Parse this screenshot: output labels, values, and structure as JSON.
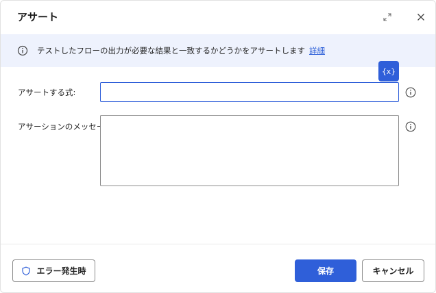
{
  "dialog": {
    "title": "アサート",
    "icons": {
      "expand": "expand-icon",
      "close": "close-icon"
    }
  },
  "info_bar": {
    "icon": "info-icon",
    "text": "テストしたフローの出力が必要な結果と一致するかどうかをアサートします",
    "link": "詳細"
  },
  "variables_button": {
    "label": "{x}"
  },
  "fields": {
    "expression": {
      "label": "アサートする式:",
      "value": "",
      "help_icon": "info-icon"
    },
    "message": {
      "label": "アサーションのメッセージ:",
      "value": "",
      "help_icon": "info-icon"
    }
  },
  "footer": {
    "on_error": {
      "label": "エラー発生時",
      "icon": "shield-icon"
    },
    "save": {
      "label": "保存"
    },
    "cancel": {
      "label": "キャンセル"
    }
  },
  "colors": {
    "accent": "#2f5fd9",
    "info_bar_bg": "#eef2fd",
    "link": "#2b5ed8"
  }
}
